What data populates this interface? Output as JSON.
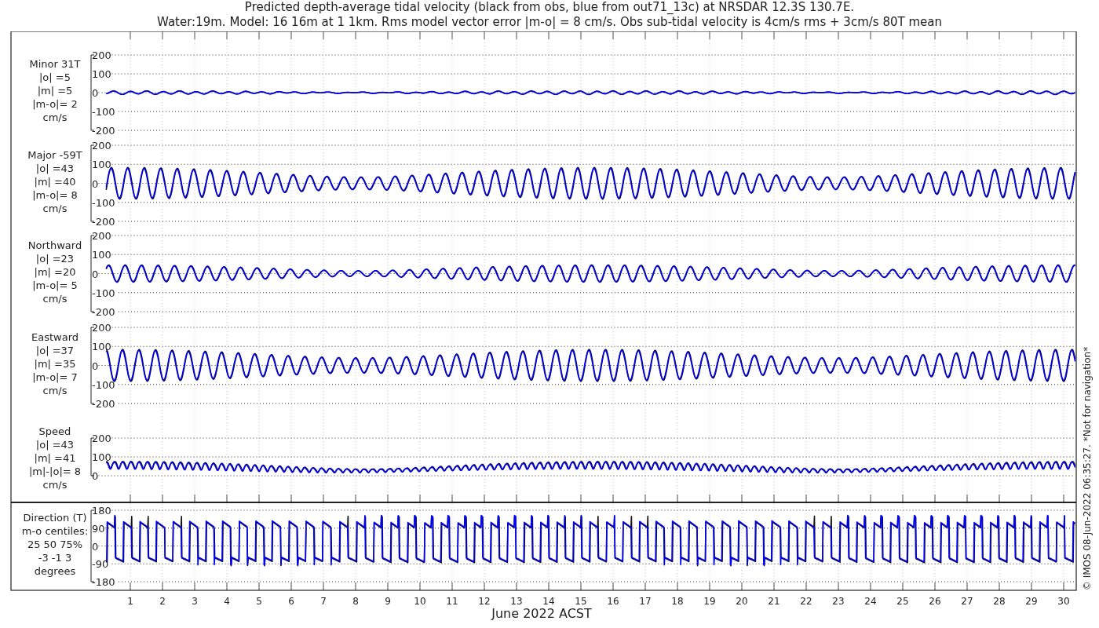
{
  "title_lines": [
    "Predicted depth-average tidal velocity (black from obs, blue from out71_13c) at NRSDAR 12.3S 130.7E.",
    "Water:19m. Model: 16 16m at 1 1km. Rms model vector error |m-o| = 8 cm/s. Obs sub-tidal velocity is 4cm/s rms + 3cm/s 80T mean"
  ],
  "panels": [
    {
      "kind": "component",
      "label_lines": [
        "Minor 31T",
        "|o| =5",
        "|m| =5",
        "|m-o|= 2",
        "cm/s"
      ],
      "yticks": [
        "200",
        "100",
        "0",
        "-100",
        "-200"
      ]
    },
    {
      "kind": "component",
      "label_lines": [
        "Major -59T",
        "|o| =43",
        "|m| =40",
        "|m-o|= 8",
        "cm/s"
      ],
      "yticks": [
        "200",
        "100",
        "0",
        "-100",
        "-200"
      ]
    },
    {
      "kind": "component",
      "label_lines": [
        "Northward",
        "|o| =23",
        "|m| =20",
        "|m-o|= 5",
        "cm/s"
      ],
      "yticks": [
        "200",
        "100",
        "0",
        "-100",
        "-200"
      ]
    },
    {
      "kind": "component",
      "label_lines": [
        "Eastward",
        "|o| =37",
        "|m| =35",
        "|m-o|= 7",
        "cm/s"
      ],
      "yticks": [
        "200",
        "100",
        "0",
        "-100",
        "-200"
      ]
    },
    {
      "kind": "speed",
      "label_lines": [
        "Speed",
        "|o| =43",
        "|m| =41",
        "|m|-|o|= 8",
        "cm/s"
      ],
      "yticks": [
        "200",
        "100",
        "0"
      ]
    },
    {
      "kind": "direction",
      "label_lines": [
        "Direction (T)",
        "m-o centiles:",
        "25  50  75%",
        "-3 -1  3",
        "degrees"
      ],
      "yticks": [
        "180",
        "90",
        "0",
        "-90",
        "-180"
      ]
    }
  ],
  "x_axis": {
    "days": [
      "1",
      "2",
      "3",
      "4",
      "5",
      "6",
      "7",
      "8",
      "9",
      "10",
      "11",
      "12",
      "13",
      "14",
      "15",
      "16",
      "17",
      "18",
      "19",
      "20",
      "21",
      "22",
      "23",
      "24",
      "25",
      "26",
      "27",
      "28",
      "29",
      "30"
    ],
    "label": "June 2022 ACST"
  },
  "credit": "© IMOS 08-Jun-2022 06:35:27. *Not for navigation*"
}
